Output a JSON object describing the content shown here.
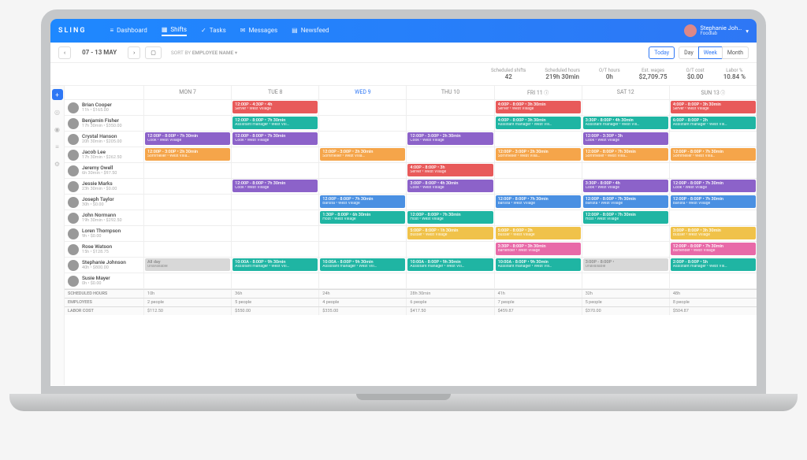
{
  "brand": "SLING",
  "nav": {
    "dashboard": "Dashboard",
    "shifts": "Shifts",
    "tasks": "Tasks",
    "messages": "Messages",
    "newsfeed": "Newsfeed"
  },
  "user": {
    "name": "Stephanie Joh…",
    "org": "Foodlab"
  },
  "toolbar": {
    "daterange": "07 - 13 MAY",
    "sort_label": "SORT BY",
    "sort_value": "EMPLOYEE NAME",
    "today": "Today",
    "day": "Day",
    "week": "Week",
    "month": "Month"
  },
  "stats": [
    {
      "label": "Scheduled shifts",
      "value": "42"
    },
    {
      "label": "Scheduled hours",
      "value": "219h 30min"
    },
    {
      "label": "O/T hours",
      "value": "0h"
    },
    {
      "label": "Est. wages",
      "value": "$2,709.75"
    },
    {
      "label": "O/T cost",
      "value": "$0.00"
    },
    {
      "label": "Labor %",
      "value": "10.84 %"
    }
  ],
  "days": [
    "MON 7",
    "TUE 8",
    "WED 9",
    "THU 10",
    "FRI 11",
    "SAT 12",
    "SUN 13"
  ],
  "colors": {
    "red": "#e85a5a",
    "teal": "#1fb5a3",
    "purple": "#8c62c9",
    "orange": "#f5a54a",
    "blue": "#4a90e2",
    "yellow": "#f0c24a",
    "pink": "#e86aa8",
    "grey": "#d8d8d8"
  },
  "employees": [
    {
      "name": "Brian Cooper",
      "meta": "11h • $165.00",
      "shifts": [
        null,
        {
          "c": "red",
          "t": "12:00P - 4:30P • 4h",
          "r": "Server • West Village"
        },
        null,
        null,
        {
          "c": "red",
          "t": "4:00P - 8:00P • 3h 30min",
          "r": "Server • West Village"
        },
        null,
        {
          "c": "red",
          "t": "4:00P - 8:00P • 3h 30min",
          "r": "Server • West Village"
        }
      ]
    },
    {
      "name": "Benjamin Fisher",
      "meta": "17h 30min • $350.00",
      "shifts": [
        null,
        {
          "c": "teal",
          "t": "12:00P - 8:00P • 7h 30min",
          "r": "Assistant manager • West Vill…"
        },
        null,
        null,
        {
          "c": "teal",
          "t": "4:00P - 8:00P • 3h 30min",
          "r": "Assistant manager • West Vill…"
        },
        {
          "c": "teal",
          "t": "3:30P - 8:00P • 4h 30min",
          "r": "Assistant manager • West Vill…"
        },
        {
          "c": "teal",
          "t": "6:00P - 8:00P • 2h",
          "r": "Assistant manager • West Vill…"
        }
      ]
    },
    {
      "name": "Crystal Hanson",
      "meta": "20h 30min • $205.00",
      "shifts": [
        {
          "c": "purple",
          "t": "12:00P - 8:00P • 7h 30min",
          "r": "Cook • West Village"
        },
        {
          "c": "purple",
          "t": "12:00P - 8:00P • 7h 30min",
          "r": "Cook • West Village"
        },
        null,
        {
          "c": "purple",
          "t": "12:00P - 3:00P • 2h 30min",
          "r": "Cook • West Village"
        },
        null,
        {
          "c": "purple",
          "t": "12:00P - 3:30P • 3h",
          "r": "Cook • West Village"
        },
        null
      ]
    },
    {
      "name": "Jacob Lee",
      "meta": "17h 30min • $262.50",
      "shifts": [
        {
          "c": "orange",
          "t": "12:00P - 3:00P • 2h 30min",
          "r": "Sommelier • West Villa…"
        },
        null,
        {
          "c": "orange",
          "t": "12:00P - 3:00P • 2h 30min",
          "r": "Sommelier • West Villa…"
        },
        null,
        {
          "c": "orange",
          "t": "12:00P - 3:00P • 2h 30min",
          "r": "Sommelier • West Villa…"
        },
        {
          "c": "orange",
          "t": "12:00P - 8:00P • 7h 30min",
          "r": "Sommelier • West Villa…"
        },
        {
          "c": "orange",
          "t": "12:00P - 8:00P • 7h 30min",
          "r": "Sommelier • West Villa…"
        }
      ]
    },
    {
      "name": "Jeremy Owell",
      "meta": "6h 30min • $97.50",
      "shifts": [
        null,
        null,
        null,
        {
          "c": "red",
          "t": "4:00P - 8:00P • 3h",
          "r": "Server • West Village"
        },
        null,
        null,
        null
      ]
    },
    {
      "name": "Jessie Marks",
      "meta": "23h 30min • $0.00",
      "shifts": [
        null,
        {
          "c": "purple",
          "t": "12:00P - 8:00P • 7h 30min",
          "r": "Cook • West Village"
        },
        null,
        {
          "c": "purple",
          "t": "3:00P - 8:00P • 4h 30min",
          "r": "Cook • West Village"
        },
        null,
        {
          "c": "purple",
          "t": "3:30P - 8:00P • 4h",
          "r": "Cook • West Village"
        },
        {
          "c": "purple",
          "t": "12:00P - 8:00P • 7h 30min",
          "r": "Cook • West Village"
        }
      ]
    },
    {
      "name": "Joseph Taylor",
      "meta": "30h • $0.00",
      "shifts": [
        null,
        null,
        {
          "c": "blue",
          "t": "12:00P - 8:00P • 7h 30min",
          "r": "Barista • West Village"
        },
        null,
        {
          "c": "blue",
          "t": "12:00P - 8:00P • 7h 30min",
          "r": "Barista • West Village"
        },
        {
          "c": "blue",
          "t": "12:00P - 8:00P • 7h 30min",
          "r": "Barista • West Village"
        },
        {
          "c": "blue",
          "t": "12:00P - 8:00P • 7h 30min",
          "r": "Barista • West Village"
        }
      ]
    },
    {
      "name": "John Normann",
      "meta": "19h 30min • $292.50",
      "shifts": [
        null,
        null,
        {
          "c": "teal",
          "t": "1:30P - 8:00P • 6h 30min",
          "r": "Host • West Village"
        },
        {
          "c": "teal",
          "t": "12:00P - 8:00P • 7h 30min",
          "r": "Host • West Village"
        },
        null,
        {
          "c": "teal",
          "t": "12:00P - 8:00P • 7h 30min",
          "r": "Host • West Village"
        },
        null
      ]
    },
    {
      "name": "Loren Thompson",
      "meta": "9h • $0.00",
      "shifts": [
        null,
        null,
        null,
        {
          "c": "yellow",
          "t": "5:00P - 8:00P • 1h 30min",
          "r": "Busser • West Village"
        },
        {
          "c": "yellow",
          "t": "5:00P - 8:00P • 2h",
          "r": "Busser • West Village"
        },
        null,
        {
          "c": "yellow",
          "t": "3:00P - 8:00P • 3h 30min",
          "r": "Busser • West Village"
        }
      ]
    },
    {
      "name": "Rose Watson",
      "meta": "15h • $128.75",
      "shifts": [
        null,
        null,
        null,
        null,
        {
          "c": "pink",
          "t": "3:30P - 8:00P • 3h 30min",
          "r": "Bartender • West Village"
        },
        null,
        {
          "c": "pink",
          "t": "12:00P - 8:00P • 7h 30min",
          "r": "Bartender • West Village"
        }
      ]
    },
    {
      "name": "Stephanie Johnson",
      "meta": "40h • $800.00",
      "shifts": [
        {
          "c": "grey",
          "t": "All day",
          "r": "Unavailable",
          "dark": true
        },
        {
          "c": "teal",
          "t": "10:00A - 8:00P • 9h 30min",
          "r": "Assistant manager • West Vill…"
        },
        {
          "c": "teal",
          "t": "10:00A - 8:00P • 9h 30min",
          "r": "Assistant manager • West Vill…"
        },
        {
          "c": "teal",
          "t": "10:00A - 8:00P • 9h 30min",
          "r": "Assistant manager • West Vill…"
        },
        {
          "c": "teal",
          "t": "10:00A - 8:00P • 9h 30min",
          "r": "Assistant manager • West Vill…"
        },
        {
          "c": "grey",
          "t": "3:00P - 8:00P •",
          "r": "Unavailable",
          "dark": true
        },
        {
          "c": "teal",
          "t": "2:00P - 8:00P • 5h",
          "r": "Assistant manager • West Vill…"
        }
      ]
    },
    {
      "name": "Susie Mayer",
      "meta": "0h • $0.00",
      "shifts": [
        null,
        null,
        null,
        null,
        null,
        null,
        null
      ]
    }
  ],
  "footer": {
    "rows": [
      {
        "label": "SCHEDULED HOURS",
        "vals": [
          "10h",
          "36h",
          "24h",
          "28h 30min",
          "41h",
          "32h",
          "48h"
        ]
      },
      {
        "label": "EMPLOYEES",
        "vals": [
          "2 people",
          "5 people",
          "4 people",
          "6 people",
          "7 people",
          "5 people",
          "8 people"
        ]
      },
      {
        "label": "LABOR COST",
        "vals": [
          "$112.50",
          "$550.00",
          "$335.00",
          "$417.50",
          "$459.87",
          "$370.00",
          "$504.87"
        ]
      }
    ]
  }
}
